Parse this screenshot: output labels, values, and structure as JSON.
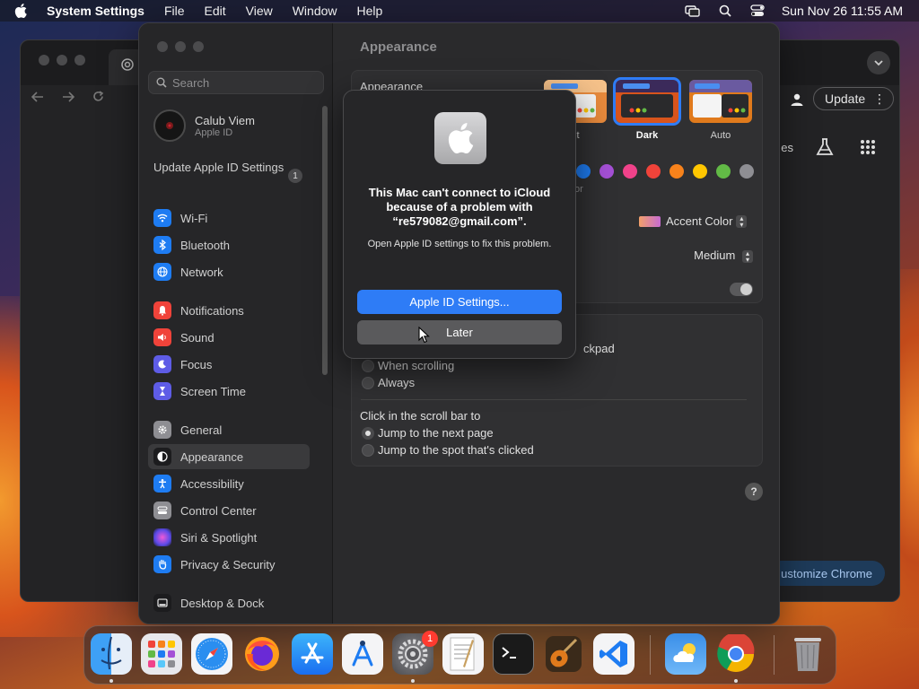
{
  "menubar": {
    "app_name": "System Settings",
    "menus": [
      "File",
      "Edit",
      "View",
      "Window",
      "Help"
    ],
    "datetime": "Sun Nov 26  11:55 AM"
  },
  "chrome": {
    "update_label": "Update",
    "partial_text": "es",
    "customize_label": "ustomize Chrome"
  },
  "sidebar": {
    "search_placeholder": "Search",
    "account_name": "Calub Viem",
    "account_sub": "Apple ID",
    "update_label": "Update Apple ID Settings",
    "update_count": "1",
    "items": [
      {
        "label": "Wi-Fi",
        "icon": "wifi-icon",
        "color": "#1e7cf2"
      },
      {
        "label": "Bluetooth",
        "icon": "bluetooth-icon",
        "color": "#1e7cf2"
      },
      {
        "label": "Network",
        "icon": "globe-icon",
        "color": "#1e7cf2"
      },
      {
        "label": "Notifications",
        "icon": "bell-icon",
        "color": "#f0433a"
      },
      {
        "label": "Sound",
        "icon": "speaker-icon",
        "color": "#f0433a"
      },
      {
        "label": "Focus",
        "icon": "moon-icon",
        "color": "#5e5ce6"
      },
      {
        "label": "Screen Time",
        "icon": "hourglass-icon",
        "color": "#5e5ce6"
      },
      {
        "label": "General",
        "icon": "gear-icon",
        "color": "#8e8e93"
      },
      {
        "label": "Appearance",
        "icon": "appearance-icon",
        "color": "#1c1c1e"
      },
      {
        "label": "Accessibility",
        "icon": "accessibility-icon",
        "color": "#1e7cf2"
      },
      {
        "label": "Control Center",
        "icon": "control-center-icon",
        "color": "#8e8e93"
      },
      {
        "label": "Siri & Spotlight",
        "icon": "siri-icon",
        "color": "#c445e0"
      },
      {
        "label": "Privacy & Security",
        "icon": "hand-icon",
        "color": "#1e7cf2"
      },
      {
        "label": "Desktop & Dock",
        "icon": "dock-icon",
        "color": "#1c1c1e"
      }
    ]
  },
  "content": {
    "title": "Appearance",
    "appearance_label": "Appearance",
    "modes": [
      "nt",
      "Dark",
      "Auto"
    ],
    "accent_colors": [
      "#1e7cf2",
      "#a550d6",
      "#f0428a",
      "#f0433a",
      "#f7821b",
      "#ffc600",
      "#62ba46",
      "#8e8e93"
    ],
    "partial_accent": "or",
    "accent_color_label": "Accent Color",
    "sidebar_size_value": "Medium",
    "scroll_partial": "ckpad",
    "when_scrolling": "When scrolling",
    "always": "Always",
    "click_scroll_label": "Click in the scroll bar to",
    "jump_next": "Jump to the next page",
    "jump_spot": "Jump to the spot that's clicked",
    "help": "?"
  },
  "dialog": {
    "title": "This Mac can't connect to iCloud because of a problem with “re579082@gmail.com”.",
    "message": "Open Apple ID settings to fix this problem.",
    "primary_label": "Apple ID Settings...",
    "secondary_label": "Later"
  },
  "dock": {
    "settings_badge": "1",
    "apps": [
      "Finder",
      "Launchpad",
      "Safari",
      "Firefox",
      "App Store",
      "Xcode Instruments",
      "System Settings",
      "TextEdit",
      "Terminal",
      "GarageBand",
      "Visual Studio Code",
      "Weather",
      "Google Chrome",
      "Trash"
    ]
  }
}
